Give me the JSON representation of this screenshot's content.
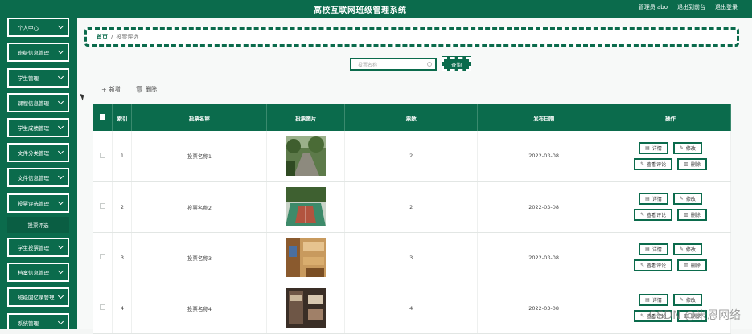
{
  "header": {
    "title": "高校互联网班级管理系统",
    "user_role": "管理员",
    "user_name": "abo",
    "front_link": "退出到前台",
    "logout_link": "退出登录"
  },
  "sidebar": {
    "items": [
      {
        "label": "个人中心"
      },
      {
        "label": "班级信息管理"
      },
      {
        "label": "学生管理"
      },
      {
        "label": "课程信息管理"
      },
      {
        "label": "学生成绩管理"
      },
      {
        "label": "文件分类管理"
      },
      {
        "label": "文件信息管理"
      },
      {
        "label": "投票评选管理"
      },
      {
        "label": "学生投票管理"
      },
      {
        "label": "档案信息管理"
      },
      {
        "label": "班级回忆录管理"
      },
      {
        "label": "系统管理"
      }
    ],
    "sub_item": "投票评选"
  },
  "breadcrumb": {
    "home": "首页",
    "current": "投票评选"
  },
  "search": {
    "placeholder": "投票名称",
    "button": "查询"
  },
  "actions": {
    "add": "新增",
    "delete": "删除"
  },
  "table": {
    "headers": [
      "索引",
      "投票名称",
      "投票图片",
      "票数",
      "发布日期",
      "操作"
    ],
    "rows": [
      {
        "index": "1",
        "name": "投票名称1",
        "votes": "2",
        "date": "2022-03-08",
        "image": "garden-photo"
      },
      {
        "index": "2",
        "name": "投票名称2",
        "votes": "2",
        "date": "2022-03-08",
        "image": "court-photo"
      },
      {
        "index": "3",
        "name": "投票名称3",
        "votes": "3",
        "date": "2022-03-08",
        "image": "dorm-photo"
      },
      {
        "index": "4",
        "name": "投票名称4",
        "votes": "4",
        "date": "2022-03-08",
        "image": "room-photo"
      }
    ],
    "ops": {
      "detail": "详情",
      "edit": "修改",
      "comments": "查看评论",
      "delete": "删除"
    }
  },
  "watermark": "CSDN @米恩网络",
  "colors": {
    "primary": "#0b6b4c"
  }
}
